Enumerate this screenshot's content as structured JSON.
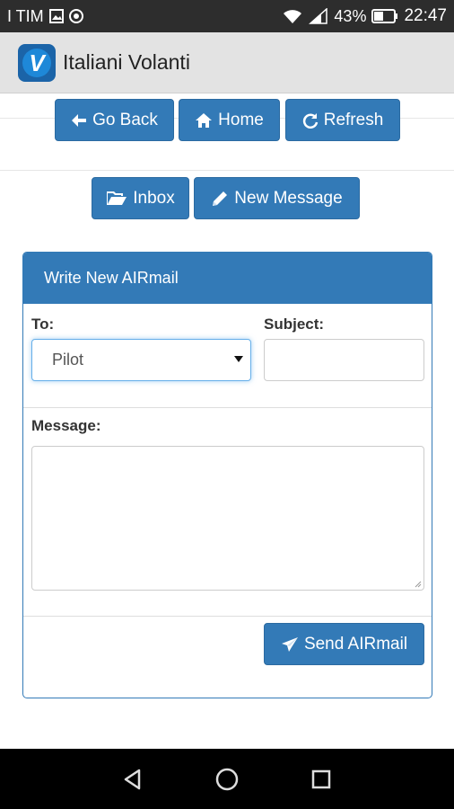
{
  "status_bar": {
    "carrier": "I TIM",
    "battery": "43%",
    "time": "22:47"
  },
  "app": {
    "title": "Italiani Volanti",
    "logo_letter": "V"
  },
  "top_nav": {
    "go_back": "Go Back",
    "home": "Home",
    "refresh": "Refresh"
  },
  "mail_nav": {
    "inbox": "Inbox",
    "new_message": "New Message"
  },
  "form": {
    "heading": "Write New AIRmail",
    "to_label": "To:",
    "to_value": "Pilot",
    "subject_label": "Subject:",
    "subject_value": "",
    "message_label": "Message:",
    "message_value": "",
    "send_label": "Send AIRmail"
  },
  "colors": {
    "primary": "#337ab7",
    "status_bar": "#2d2d2d",
    "app_bar": "#e3e3e3"
  },
  "icons": {
    "go_back": "arrow-left-icon",
    "home": "home-icon",
    "refresh": "refresh-icon",
    "inbox": "folder-open-icon",
    "new_message": "pencil-icon",
    "send": "send-icon"
  }
}
